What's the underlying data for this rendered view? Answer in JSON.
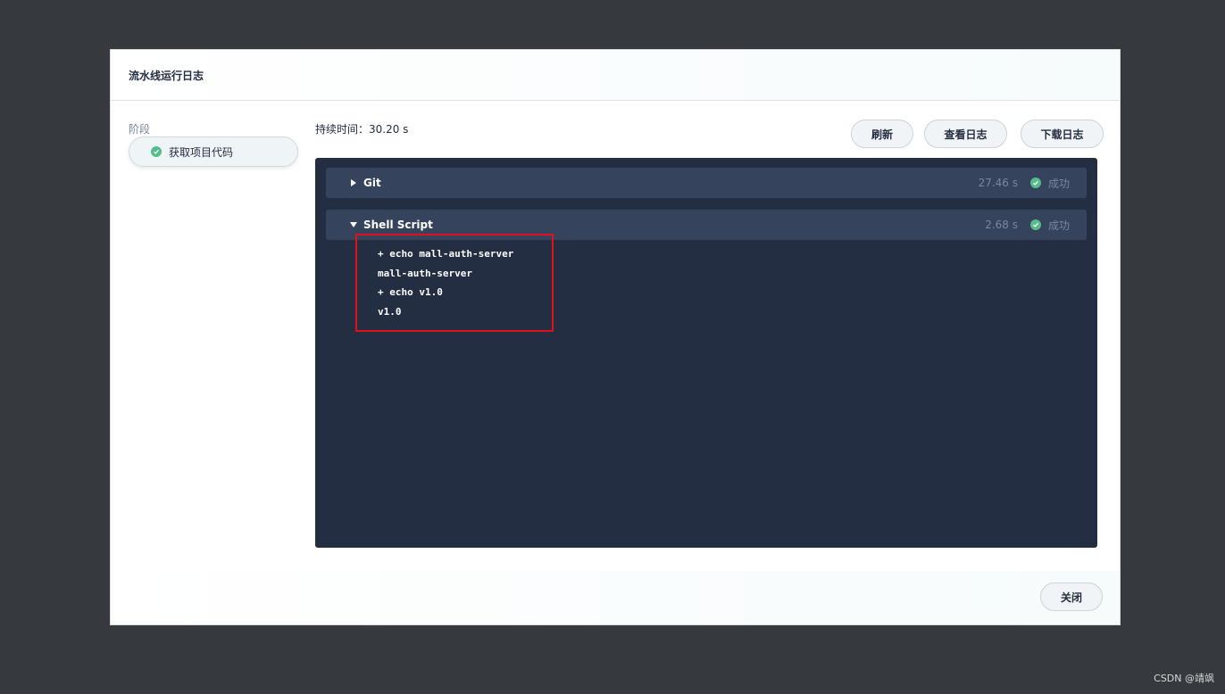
{
  "modal": {
    "title": "流水线运行日志",
    "stage_label": "阶段",
    "stages": [
      {
        "name": "获取项目代码",
        "status_icon": "check-circle-icon"
      }
    ],
    "duration": "持续时间：30.20 s",
    "buttons": {
      "refresh": "刷新",
      "view_log": "查看日志",
      "download_log": "下载日志"
    },
    "log_rows": [
      {
        "name": "Git",
        "time": "27.46 s",
        "status": "成功",
        "expanded": false
      },
      {
        "name": "Shell Script",
        "time": "2.68 s",
        "status": "成功",
        "expanded": true
      }
    ],
    "shell_output": [
      "+ echo mall-auth-server",
      "mall-auth-server",
      "+ echo v1.0",
      "v1.0"
    ],
    "close_label": "关闭"
  },
  "watermark": "CSDN @靖飒",
  "colors": {
    "success": "#55bc8a",
    "log_background": "#242e42",
    "row_background": "#36435c",
    "highlight": "#e0111a"
  }
}
